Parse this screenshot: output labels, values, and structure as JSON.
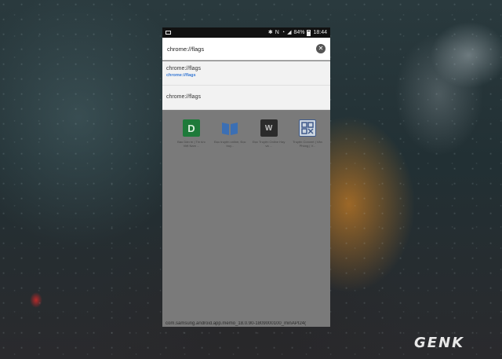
{
  "status_bar": {
    "battery": "84%",
    "time": "18:44"
  },
  "address_bar": {
    "value": "chrome://flags"
  },
  "suggestions": [
    {
      "title": "chrome://flags",
      "url": "chrome://flags"
    },
    {
      "title": "chrome://flags"
    }
  ],
  "tiles": [
    {
      "icon_letter": "D",
      "icon_color": "#1e7a3a",
      "label": "Báo Dân trí | Tin tức Việt Nam ..."
    },
    {
      "icon_letter": "",
      "icon_color": "#3b6fb4",
      "label": "Đọc truyện online, Đọc truy..."
    },
    {
      "icon_letter": "W",
      "icon_color": "#2b2b2b",
      "label": "Đọc Truyện Online Hay và ..."
    },
    {
      "icon_letter": "",
      "icon_color": "#3f5a8a",
      "label": "Truyện Convert | Văn Phòng | V..."
    }
  ],
  "bottom_text": "com.samsung.android.app.memo_18.0.90-1809000100_minAPI24(",
  "watermark": "GENK"
}
